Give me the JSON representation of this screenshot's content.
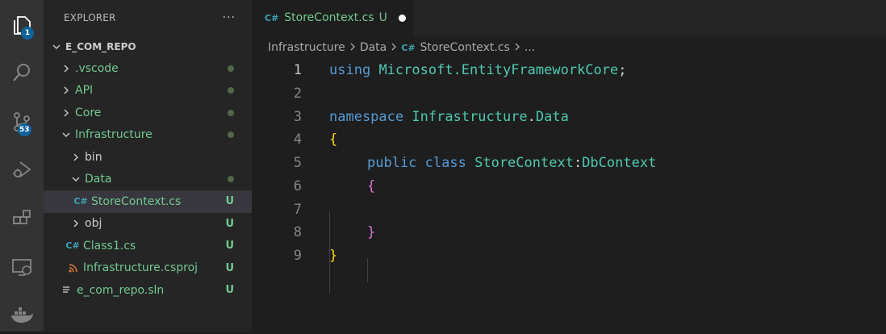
{
  "activity_bar": {
    "explorer_badge": "1",
    "source_control_badge": "53",
    "icons": [
      "files-icon",
      "search-icon",
      "source-control-icon",
      "run-debug-icon",
      "extensions-icon",
      "remote-explorer-icon",
      "docker-icon"
    ]
  },
  "sidebar": {
    "title": "EXPLORER",
    "more": "···",
    "section": "E_COM_REPO",
    "items": [
      {
        "label": ".vscode",
        "status": "dot"
      },
      {
        "label": "API",
        "status": "dot"
      },
      {
        "label": "Core",
        "status": "dot"
      },
      {
        "label": "Infrastructure",
        "status": "dot"
      },
      {
        "label": "bin",
        "status": ""
      },
      {
        "label": "Data",
        "status": "dot"
      },
      {
        "label": "StoreContext.cs",
        "status": "U",
        "icon": "C#"
      },
      {
        "label": "obj",
        "status": "U"
      },
      {
        "label": "Class1.cs",
        "status": "U",
        "icon": "C#"
      },
      {
        "label": "Infrastructure.csproj",
        "status": "U",
        "icon": "rss"
      },
      {
        "label": "e_com_repo.sln",
        "status": "U",
        "icon": "lines"
      }
    ]
  },
  "tab": {
    "label": "StoreContext.cs",
    "status": "U",
    "icon": "C#"
  },
  "breadcrumb": [
    "Infrastructure",
    "Data",
    "StoreContext.cs",
    "..."
  ],
  "code": {
    "line_numbers": [
      "1",
      "2",
      "3",
      "4",
      "5",
      "6",
      "7",
      "8",
      "9"
    ],
    "l1_kw": "using",
    "l1_ns": "Microsoft.EntityFrameworkCore",
    "l1_end": ";",
    "l3_kw": "namespace",
    "l3_ns1": "Infrastructure",
    "l3_dot": ".",
    "l3_ns2": "Data",
    "l4": "{",
    "l5_public": "public",
    "l5_class": "class",
    "l5_name": "StoreContext",
    "l5_colon": ":",
    "l5_base": "DbContext",
    "l6": "{",
    "l8": "}",
    "l9": "}"
  },
  "colors": {
    "keyword": "#569cd6",
    "type": "#4ec9b0",
    "bracket_level1": "#ffd700",
    "bracket_level2": "#da70d6",
    "git_untracked": "#73c991"
  }
}
